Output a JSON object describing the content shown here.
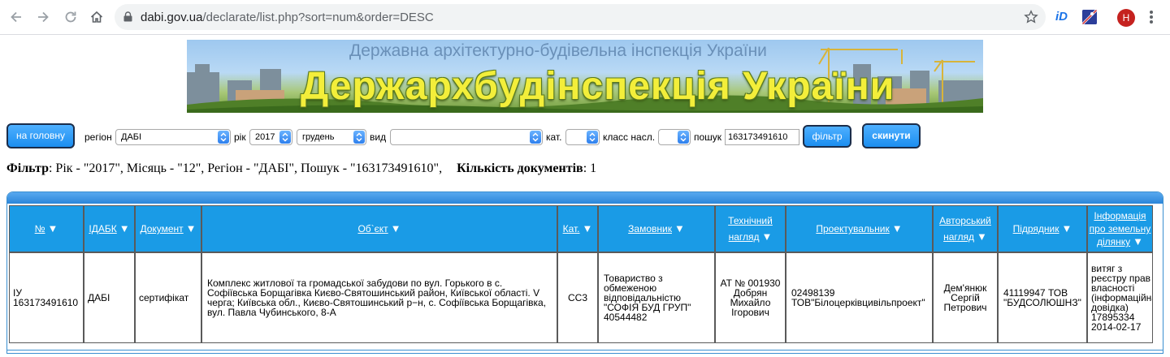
{
  "browser": {
    "url_domain": "dabi.gov.ua",
    "url_path": "/declarate/list.php?sort=num&order=DESC",
    "avatar_letter": "H",
    "ext_label": "iD"
  },
  "banner": {
    "subtitle": "Державна архітектурно-будівельна інспекція України",
    "title": "Держархбудінспекція України"
  },
  "filters": {
    "home_button": "на головну",
    "region_label": "регіон",
    "region_value": "ДАБІ",
    "year_label": "рік",
    "year_value": "2017",
    "month_value": "грудень",
    "kind_label": "вид",
    "kind_value": "",
    "cat_label": "кат.",
    "cat_value": "",
    "class_label": "класс насл.",
    "class_value": "",
    "search_label": "пошук",
    "search_value": "163173491610",
    "filter_button": "фільтр",
    "reset_button": "скинути"
  },
  "summary": {
    "filter_label": "Фільтр",
    "filter_text": ": Рік - \"2017\", Місяць - \"12\", Регіон - \"ДАБІ\", Пошук - \"163173491610\",",
    "count_label": "Кількість документів",
    "count_value": ": 1"
  },
  "table": {
    "headers": {
      "num": "№",
      "idabk": "ІДАБК",
      "document": "Документ",
      "object": "Об`єкт",
      "cat": "Кат.",
      "customer": "Замовник",
      "tech_l1": "Технічний",
      "tech_l2": "нагляд",
      "designer": "Проектувальник",
      "author_l1": "Авторський",
      "author_l2": "нагляд",
      "contractor": "Підрядник",
      "land_l1": "Інформація",
      "land_l2": "про земельну",
      "land_l3": "ділянку"
    },
    "row": {
      "num_l1": "ІУ",
      "num_l2": "163173491610",
      "idabk": "ДАБІ",
      "document": "сертифікат",
      "object_l1": "Комплекс житлової та громадської забудови по вул. Горького в с.",
      "object_l2": "Софіївська Борщагівка Києво-Святошинський район, Київської області. V",
      "object_l3": "черга; Київська обл., Києво-Святошинський р−н, с. Софіївська Борщагівка,",
      "object_l4": "вул. Павла Чубинського, 8-А",
      "cat": "СС3",
      "customer_l1": "Товариство з",
      "customer_l2": "обмеженою",
      "customer_l3": "відповідальністю",
      "customer_l4": "\"СОФІЯ БУД ГРУП\"",
      "customer_l5": "40544482",
      "tech_l1": "АТ № 001930",
      "tech_l2": "Добрян",
      "tech_l3": "Михайло",
      "tech_l4": "Ігорович",
      "designer_l1": "02498139",
      "designer_l2": "ТОВ\"Білоцерківцивільпроект\"",
      "author_l1": "Дем'янюк",
      "author_l2": "Сергій",
      "author_l3": "Петрович",
      "contractor_l1": "41119947 ТОВ",
      "contractor_l2": "\"БУДСОЛЮШНЗ\"",
      "land_l1": "витяг з",
      "land_l2": "реєстру прав",
      "land_l3": "власності",
      "land_l4": "(інформаційна",
      "land_l5": "довідка)",
      "land_l6": "17895334",
      "land_l7": "2014-02-17"
    }
  }
}
